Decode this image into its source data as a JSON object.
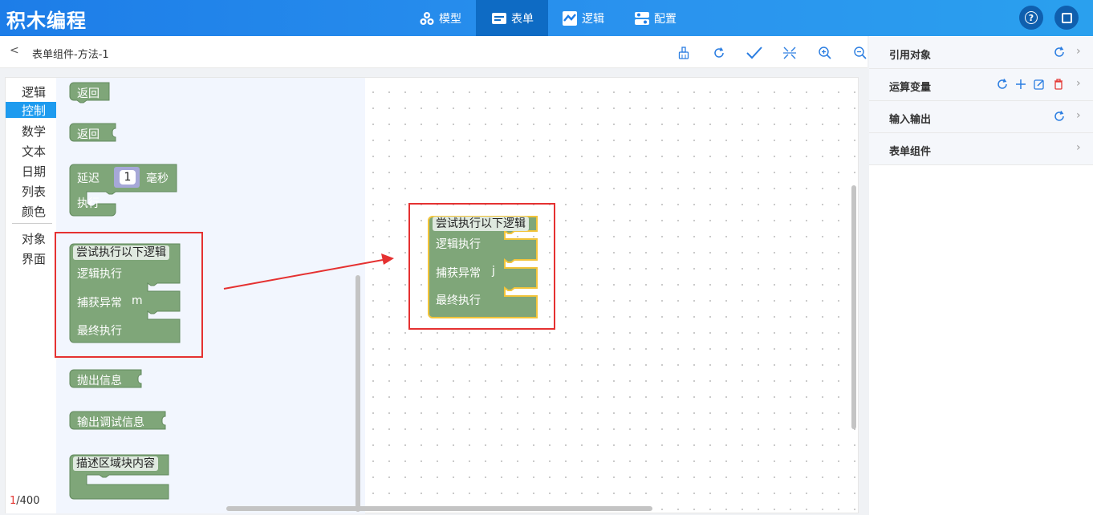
{
  "app": {
    "title": "积木编程"
  },
  "nav": [
    {
      "label": "模型"
    },
    {
      "label": "表单"
    },
    {
      "label": "逻辑"
    },
    {
      "label": "配置"
    }
  ],
  "topright": {
    "help": "?",
    "window": "□"
  },
  "subbar": {
    "back": "<",
    "title": "表单组件-方法-1"
  },
  "categories": [
    "逻辑",
    "控制",
    "数学",
    "文本",
    "日期",
    "列表",
    "颜色",
    "对象",
    "界面"
  ],
  "active_category": "控制",
  "counter": {
    "current": "1",
    "total": "/400"
  },
  "flyout": {
    "return1": "返回",
    "return2": "返回",
    "delay": {
      "label": "延迟",
      "value": "1",
      "unit": "毫秒",
      "exec": "执行"
    },
    "try": {
      "header": "尝试执行以下逻辑",
      "try_label": "逻辑执行",
      "catch_label": "捕获异常",
      "catch_var": "m",
      "finally_label": "最终执行"
    },
    "throw": "抛出信息",
    "debug": "输出调试信息",
    "describe": "描述区域块内容"
  },
  "canvas_block": {
    "header": "尝试执行以下逻辑",
    "try_label": "逻辑执行",
    "catch_label": "捕获异常",
    "catch_var": "j",
    "finally_label": "最终执行"
  },
  "right_panel": [
    {
      "label": "引用对象"
    },
    {
      "label": "运算变量"
    },
    {
      "label": "输入输出"
    },
    {
      "label": "表单组件"
    }
  ],
  "colors": {
    "block": "#7fa679",
    "block_stroke": "#62895d",
    "highlight": "#e53131",
    "selected": "#f2c43a",
    "accent": "#1e9bef"
  }
}
